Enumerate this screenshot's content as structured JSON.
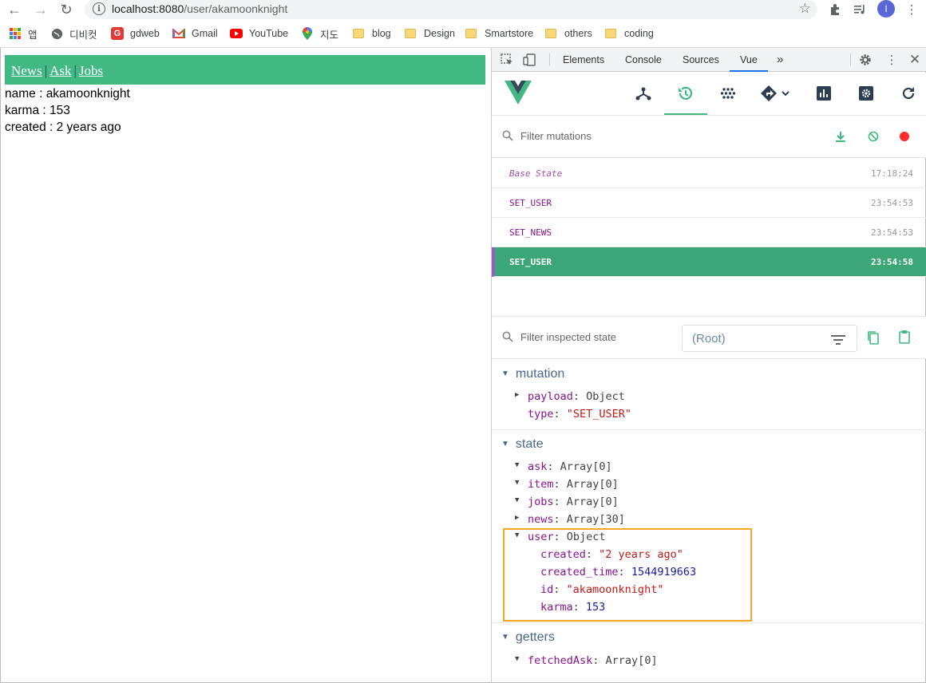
{
  "browser": {
    "url_host": "localhost:8080",
    "url_path": "/user/akamoonknight",
    "profile_initial": "I",
    "bookmarks": [
      {
        "label": "앱",
        "icon": "apps-grid-icon"
      },
      {
        "label": "디비컷",
        "icon": "globe-icon"
      },
      {
        "label": "gdweb",
        "icon": "gdweb-icon"
      },
      {
        "label": "Gmail",
        "icon": "gmail-icon"
      },
      {
        "label": "YouTube",
        "icon": "youtube-icon"
      },
      {
        "label": "지도",
        "icon": "maps-pin-icon"
      },
      {
        "label": "blog",
        "icon": "folder-icon"
      },
      {
        "label": "Design",
        "icon": "folder-icon"
      },
      {
        "label": "Smartstore",
        "icon": "folder-icon"
      },
      {
        "label": "others",
        "icon": "folder-icon"
      },
      {
        "label": "coding",
        "icon": "folder-icon"
      }
    ]
  },
  "page": {
    "nav": [
      "News",
      "Ask",
      "Jobs"
    ],
    "nav_sep": "|",
    "lines": [
      "name : akamoonknight",
      "karma : 153",
      "created : 2 years ago"
    ]
  },
  "devtools": {
    "tabs": [
      "Elements",
      "Console",
      "Sources",
      "Vue"
    ],
    "active_tab": "Vue",
    "more": "»",
    "accent": "#42b883",
    "mutation_filter_placeholder": "Filter mutations",
    "mutations": [
      {
        "name": "Base State",
        "time": "17:18:24",
        "base": true
      },
      {
        "name": "SET_USER",
        "time": "23:54:53"
      },
      {
        "name": "SET_NEWS",
        "time": "23:54:53"
      },
      {
        "name": "SET_USER",
        "time": "23:54:58",
        "active": true
      }
    ],
    "state_filter_placeholder": "Filter inspected state",
    "root_select": "(Root)",
    "mutation_section": {
      "title": "mutation",
      "rows": [
        {
          "key": "payload",
          "value": "Object"
        },
        {
          "key": "type",
          "value": "\"SET_USER\""
        }
      ]
    },
    "state_section": {
      "title": "state",
      "rows": [
        {
          "key": "ask",
          "value": "Array[0]"
        },
        {
          "key": "item",
          "value": "Array[0]"
        },
        {
          "key": "jobs",
          "value": "Array[0]"
        },
        {
          "key": "news",
          "value": "Array[30]"
        },
        {
          "key": "user",
          "value": "Object"
        }
      ],
      "user_fields": [
        {
          "key": "created",
          "value": "\"2 years ago\""
        },
        {
          "key": "created_time",
          "value": "1544919663"
        },
        {
          "key": "id",
          "value": "\"akamoonknight\""
        },
        {
          "key": "karma",
          "value": "153"
        }
      ]
    },
    "getters_section": {
      "title": "getters",
      "rows": [
        {
          "key": "fetchedAsk",
          "value": "Array[0]"
        }
      ]
    }
  }
}
